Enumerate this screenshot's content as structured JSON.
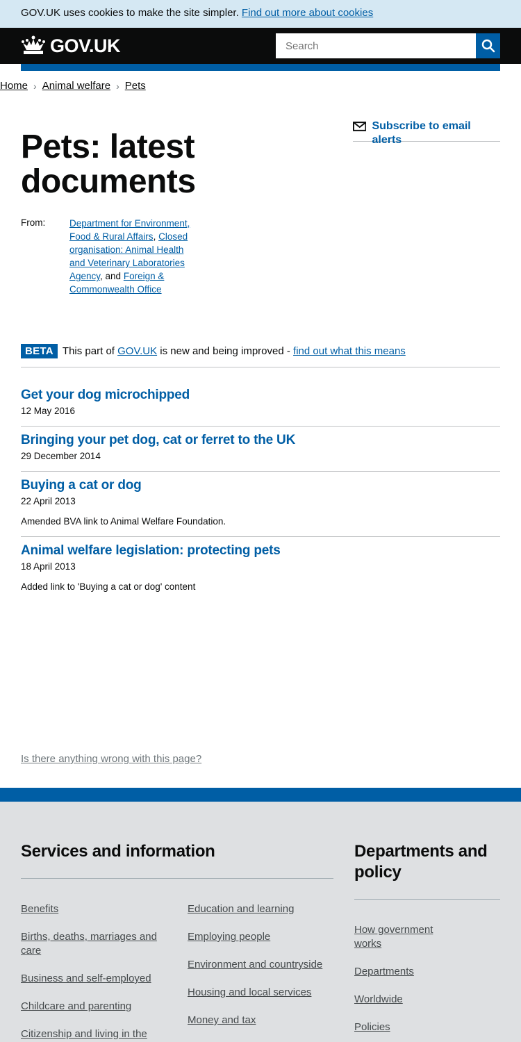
{
  "cookie_banner": {
    "text": "GOV.UK uses cookies to make the site simpler.",
    "link": "Find out more about cookies"
  },
  "header": {
    "logo_text": "GOV.UK",
    "search_placeholder": "Search",
    "search_button_icon": "magnifier-icon"
  },
  "breadcrumbs": [
    "Home",
    "Animal welfare",
    "Pets"
  ],
  "subscribe": {
    "label": "Subscribe to email alerts",
    "icon": "envelope-icon"
  },
  "page_title": "Pets: latest documents",
  "from": {
    "label": "From:",
    "org1": "Department for Environment, Food & Rural Affairs",
    "sep1": ",",
    "org2": "Closed organisation: Animal Health and Veterinary Laboratories Agency",
    "sep2": ", and",
    "org3": "Foreign & Commonwealth Office"
  },
  "beta": {
    "tag": "BETA",
    "text_before": "This part of",
    "gov_link": "GOV.UK",
    "text_after": "is new and being improved -",
    "link": "find out what this means"
  },
  "documents": [
    {
      "title": "Get your dog microchipped",
      "date": "12 May 2016",
      "note": ""
    },
    {
      "title": "Bringing your pet dog, cat or ferret to the UK",
      "date": "29 December 2014",
      "note": ""
    },
    {
      "title": "Buying a cat or dog",
      "date": "22 April 2013",
      "note": "Amended BVA link to Animal Welfare Foundation."
    },
    {
      "title": "Animal welfare legislation: protecting pets",
      "date": "18 April 2013",
      "note": "Added link to 'Buying a cat or dog' content"
    }
  ],
  "report_link": "Is there anything wrong with this page?",
  "footer": {
    "services_title": "Services and information",
    "services_col1": [
      "Benefits",
      "Births, deaths, marriages and care",
      "Business and self-employed",
      "Childcare and parenting",
      "Citizenship and living in the"
    ],
    "services_col2": [
      "Education and learning",
      "Employing people",
      "Environment and countryside",
      "Housing and local services",
      "Money and tax"
    ],
    "departments_title": "Departments and policy",
    "departments_links": [
      "How government works",
      "Departments",
      "Worldwide",
      "Policies"
    ]
  },
  "colors": {
    "link": "#005ea5",
    "header_bg": "#0b0c0c",
    "cookie_bg": "#d5e8f3",
    "footer_bg": "#dee0e2"
  }
}
